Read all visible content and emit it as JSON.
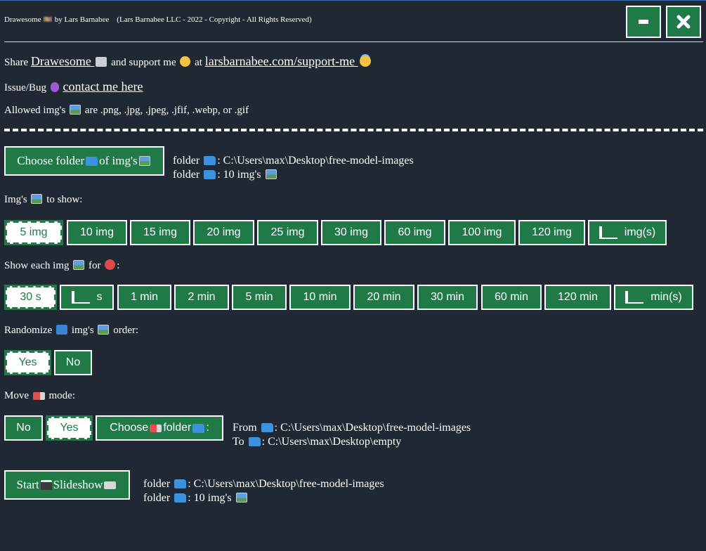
{
  "titlebar": {
    "title": "Drawesome 🎞️ by Lars Barnabee    (Lars Barnabee LLC - 2022 - Copyright - All Rights Reserved)",
    "minimize_icon": "minus-icon",
    "close_icon": "x-icon"
  },
  "info": {
    "share_prefix": "Share ",
    "share_link": "Drawesome ",
    "share_mid": " and support me ",
    "share_at": " at ",
    "support_link": "larsbarnabee.com/support-me ",
    "issue_prefix": "Issue/Bug ",
    "issue_link": "contact me here",
    "allowed_prefix": "Allowed img's ",
    "allowed_suffix": " are .png, .jpg, .jpeg, .jfif, .webp, or .gif"
  },
  "folder_section": {
    "choose_label_a": "Choose folder ",
    "choose_label_b": " of img's ",
    "folder_line1_prefix": "folder ",
    "folder_line1_value": ": C:\\Users\\max\\Desktop\\free-model-images",
    "folder_line2_prefix": "folder ",
    "folder_line2_value": ": 10 img's "
  },
  "img_count": {
    "label_a": "Img's ",
    "label_b": " to show:",
    "options": [
      "5 img",
      "10 img",
      "15 img",
      "20 img",
      "25 img",
      "30 img",
      "60 img",
      "100 img",
      "120 img"
    ],
    "selected": "5 img",
    "custom_suffix": "img(s)"
  },
  "duration": {
    "label_a": "Show each img ",
    "label_b": " for ",
    "label_c": ":",
    "selected": "30 s",
    "custom_s_suffix": "s",
    "options": [
      "1 min",
      "2 min",
      "5 min",
      "10 min",
      "20 min",
      "30 min",
      "60 min",
      "120 min"
    ],
    "custom_min_suffix": "min(s)"
  },
  "randomize": {
    "label_a": "Randomize ",
    "label_b": " img's ",
    "label_c": " order:",
    "yes": "Yes",
    "no": "No",
    "selected": "Yes"
  },
  "move_mode": {
    "label_a": "Move ",
    "label_b": " mode:",
    "no": "No",
    "yes": "Yes",
    "selected": "Yes",
    "choose_a": "Choose ",
    "choose_b": " folder ",
    "choose_c": ":",
    "from_label": "From ",
    "from_value": ":  C:\\Users\\max\\Desktop\\free-model-images",
    "to_label": "To ",
    "to_value": ":  C:\\Users\\max\\Desktop\\empty"
  },
  "start": {
    "label_a": "Start ",
    "label_b": " Slideshow ",
    "folder_line1_prefix": "folder ",
    "folder_line1_value": ": C:\\Users\\max\\Desktop\\free-model-images",
    "folder_line2_prefix": "folder ",
    "folder_line2_value": ": 10 img's "
  },
  "colors": {
    "background": "#202833",
    "button_green": "#1f7a48",
    "selected_bg": "#ffffff",
    "text": "#ffffff"
  }
}
